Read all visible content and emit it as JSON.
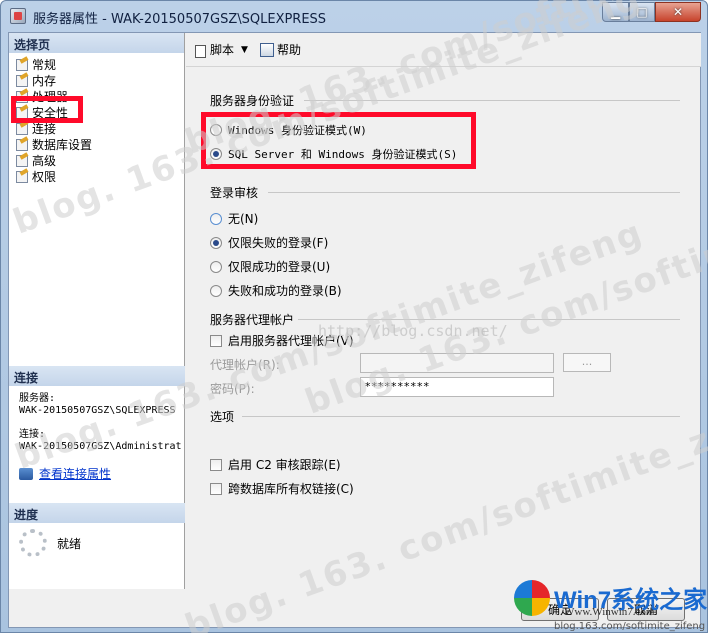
{
  "window": {
    "title": "服务器属性 - WAK-20150507GSZ\\SQLEXPRESS",
    "buttons": {
      "minimize": "▁",
      "maximize": "□",
      "close": "✕"
    }
  },
  "left_pane": {
    "select_page_header": "选择页",
    "pages": [
      {
        "label": "常规",
        "icon": "page-icon"
      },
      {
        "label": "内存",
        "icon": "page-icon"
      },
      {
        "label": "处理器",
        "icon": "page-icon"
      },
      {
        "label": "安全性",
        "icon": "page-icon"
      },
      {
        "label": "连接",
        "icon": "page-icon"
      },
      {
        "label": "数据库设置",
        "icon": "page-icon"
      },
      {
        "label": "高级",
        "icon": "page-icon"
      },
      {
        "label": "权限",
        "icon": "page-icon"
      }
    ],
    "connection": {
      "header": "连接",
      "server_label": "服务器:",
      "server_value": "WAK-20150507GSZ\\SQLEXPRESS",
      "connection_label": "连接:",
      "connection_value": "WAK-20150507GSZ\\Administrat",
      "view_properties_link": "查看连接属性"
    },
    "progress": {
      "header": "进度",
      "status": "就绪"
    }
  },
  "toolbar": {
    "script_label": "脚本",
    "help_label": "帮助"
  },
  "security": {
    "server_auth": {
      "title": "服务器身份验证",
      "options": [
        {
          "label": "Windows 身份验证模式(W)",
          "checked": false
        },
        {
          "label": "SQL Server 和 Windows 身份验证模式(S)",
          "checked": true
        }
      ]
    },
    "login_audit": {
      "title": "登录审核",
      "options": [
        {
          "label": "无(N)",
          "checked": false
        },
        {
          "label": "仅限失败的登录(F)",
          "checked": true
        },
        {
          "label": "仅限成功的登录(U)",
          "checked": false
        },
        {
          "label": "失败和成功的登录(B)",
          "checked": false
        }
      ]
    },
    "proxy_account": {
      "title": "服务器代理帐户",
      "enable_label": "启用服务器代理帐户(V)",
      "proxy_label": "代理帐户(R):",
      "proxy_value": "",
      "browse_label": "...",
      "password_label": "密码(P):",
      "password_value": "**********"
    },
    "options": {
      "title": "选项",
      "c2_audit": "启用 C2 审核跟踪(E)",
      "cross_db_chaining": "跨数据库所有权链接(C)"
    }
  },
  "footer": {
    "ok_label": "确定",
    "cancel_label": "取消"
  },
  "watermarks": {
    "blog": "blog. 163. com/softimite_zifeng",
    "csdn": "http://blog.csdn.net/"
  },
  "logo": {
    "main": "Win7系统之家",
    "sub": "Www.Winwin7.com",
    "url": "blog.163.com/softimite_zifeng"
  },
  "colors": {
    "highlight": "#ff0a2a",
    "link": "#0033cc"
  }
}
